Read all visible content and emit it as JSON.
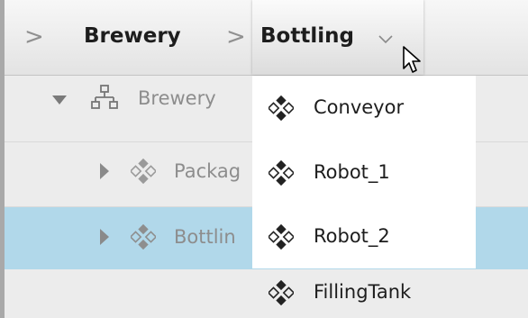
{
  "breadcrumb": {
    "items": [
      {
        "label": "Brewery"
      },
      {
        "label": "Bottling"
      }
    ]
  },
  "tree": {
    "rows": [
      {
        "label": "Brewery",
        "expanded": true,
        "icon": "hierarchy-icon"
      },
      {
        "label": "Packag",
        "expanded": false,
        "icon": "object-icon"
      },
      {
        "label": "Bottlin",
        "expanded": false,
        "icon": "object-icon",
        "selected": true
      }
    ]
  },
  "dropdown": {
    "items": [
      {
        "label": "Conveyor",
        "icon": "object-icon"
      },
      {
        "label": "Robot_1",
        "icon": "object-icon"
      },
      {
        "label": "Robot_2",
        "icon": "object-icon"
      },
      {
        "label": "FillingTank",
        "icon": "object-icon"
      }
    ]
  },
  "colors": {
    "selection": "#b1d8ea",
    "menu_bg": "#ffffff",
    "text": "#1d1d1d",
    "muted": "#8d8d8d"
  }
}
